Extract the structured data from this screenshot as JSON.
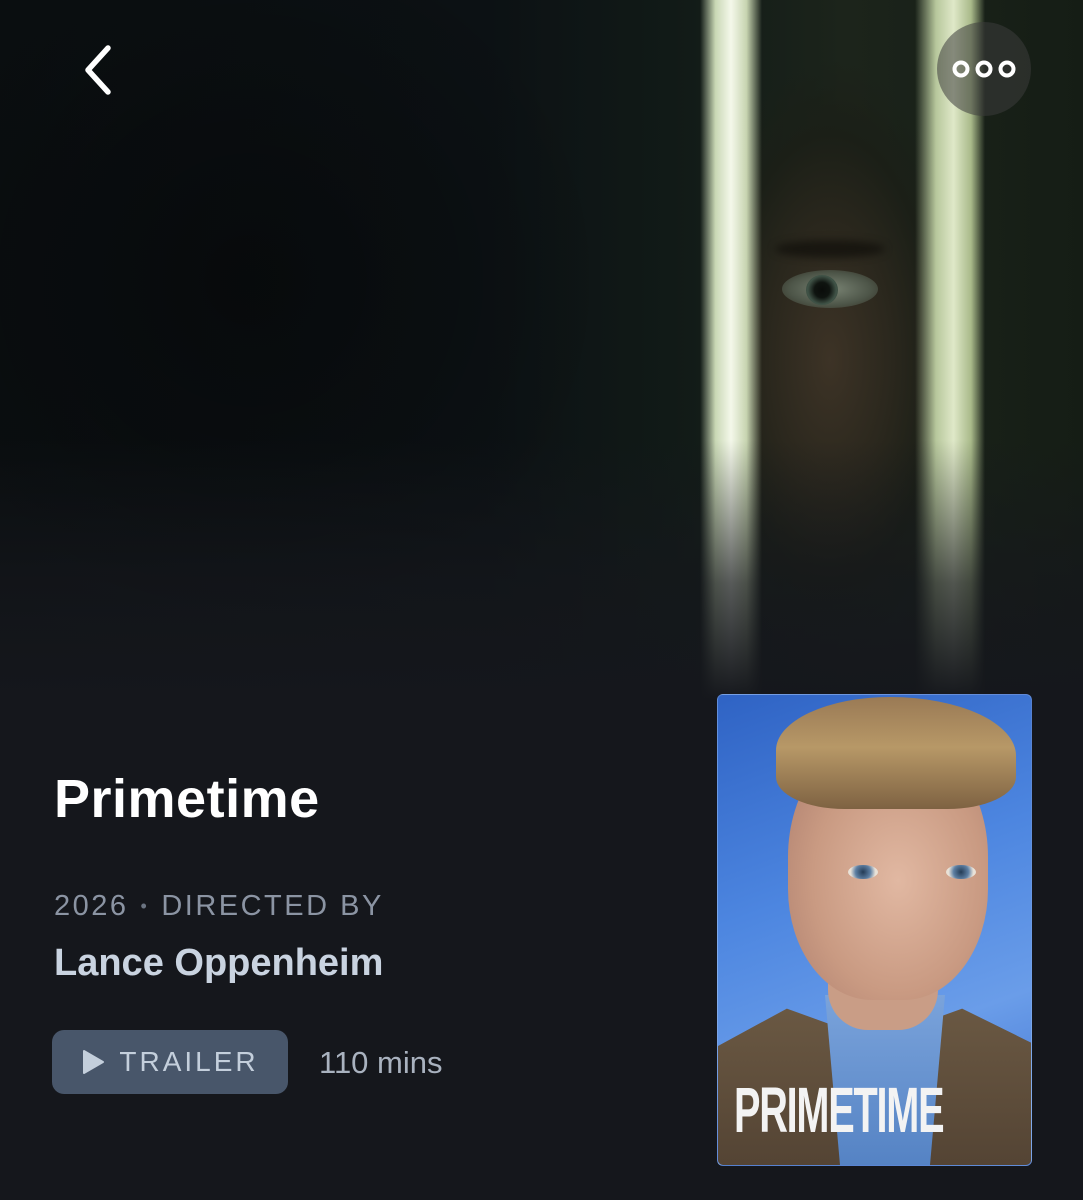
{
  "movie": {
    "title": "Primetime",
    "year": "2026",
    "separator": "•",
    "directed_by_label": "DIRECTED BY",
    "director": "Lance Oppenheim",
    "runtime": "110 mins"
  },
  "actions": {
    "trailer_label": "TRAILER",
    "back_icon": "chevron-left-icon",
    "more_icon": "more-horizontal-icon"
  },
  "poster": {
    "title": "PRIMETIME"
  },
  "colors": {
    "background": "#15171c",
    "trailer_button": "#48566a",
    "director_text": "#c9d3e0",
    "meta_text": "#8b94a3"
  }
}
